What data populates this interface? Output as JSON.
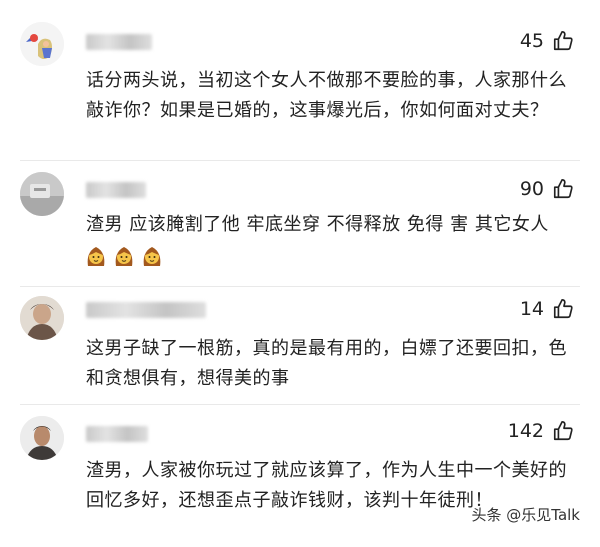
{
  "comments": [
    {
      "likes": "45",
      "text": "话分两头说，当初这个女人不做那不要脸的事，人家那什么敲诈你？如果是已婚的，这事爆光后，你如何面对丈夫？"
    },
    {
      "likes": "90",
      "text": "渣男 应该腌割了他 牢底坐穿 不得释放 免得 害 其它女人",
      "emojis": [
        "woman-emoji",
        "woman-emoji",
        "woman-emoji"
      ]
    },
    {
      "likes": "14",
      "text": "这男子缺了一根筋，真的是最有用的，白嫖了还要回扣，色和贪想俱有，想得美的事"
    },
    {
      "likes": "142",
      "text": "渣男，人家被你玩过了就应该算了，作为人生中一个美好的回忆多好，还想歪点子敲诈钱财，该判十年徒刑！"
    }
  ],
  "watermark": "头条 @乐见Talk",
  "icons": {
    "like": "thumbs-up-icon",
    "avatar": "avatar"
  },
  "colors": {
    "text": "#222222",
    "divider": "#e9e9e9",
    "background": "#ffffff"
  }
}
